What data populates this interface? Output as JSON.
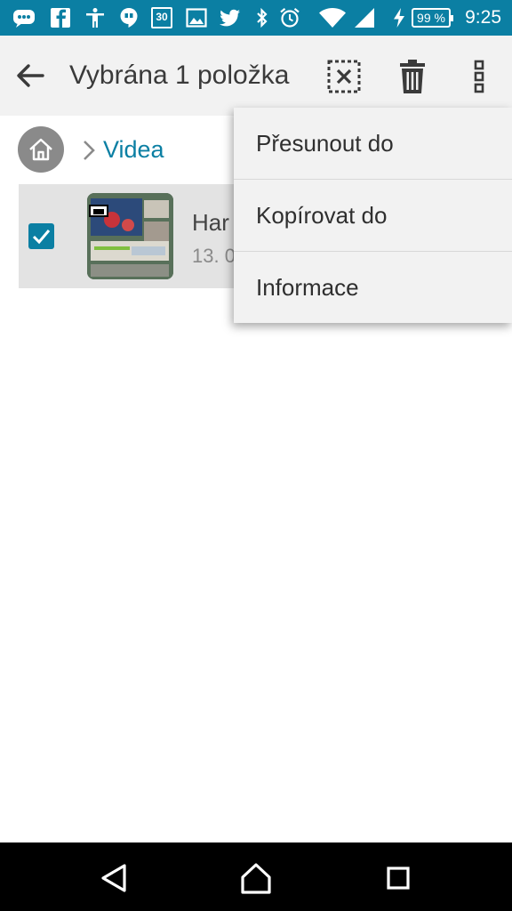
{
  "status_bar": {
    "icons": [
      "messenger-icon",
      "facebook-icon",
      "accessibility-icon",
      "hangouts-icon",
      "calendar-icon",
      "gallery-icon",
      "twitter-icon",
      "bluetooth-icon",
      "alarm-icon",
      "wifi-icon",
      "signal-icon",
      "charging-icon"
    ],
    "calendar_day": "30",
    "battery": "99 %",
    "time": "9:25",
    "color": "#0b7fa3"
  },
  "toolbar": {
    "title": "Vybrána 1 položka",
    "actions": [
      "deselect-icon",
      "delete-icon",
      "overflow-menu-icon"
    ]
  },
  "breadcrumb": {
    "home_icon": "home-icon",
    "current": "Videa"
  },
  "file": {
    "name": "Har",
    "date": "13. 0",
    "selected": true
  },
  "menu": {
    "items": [
      {
        "label": "Přesunout do"
      },
      {
        "label": "Kopírovat do"
      },
      {
        "label": "Informace"
      }
    ]
  },
  "nav_bar": {
    "buttons": [
      "back-icon",
      "home-icon",
      "recents-icon"
    ]
  }
}
